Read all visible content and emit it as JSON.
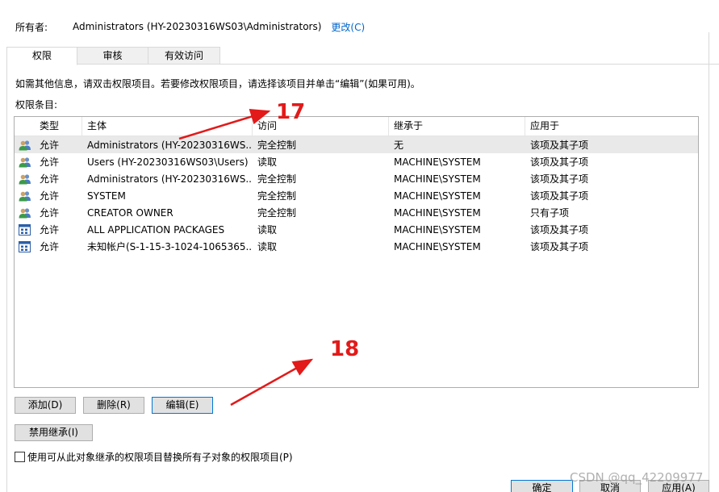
{
  "owner": {
    "label": "所有者:",
    "value": "Administrators (HY-20230316WS03\\Administrators)",
    "change_link": "更改(C)"
  },
  "tabs": [
    {
      "label": "权限",
      "active": true
    },
    {
      "label": "审核",
      "active": false
    },
    {
      "label": "有效访问",
      "active": false
    }
  ],
  "info_text": "如需其他信息，请双击权限项目。若要修改权限项目，请选择该项目并单击“编辑”(如果可用)。",
  "permission_entries_label": "权限条目:",
  "columns": {
    "type": "类型",
    "principal": "主体",
    "access": "访问",
    "inherited_from": "继承于",
    "applies_to": "应用于"
  },
  "rows": [
    {
      "icon": "user-group-icon",
      "type": "允许",
      "principal": "Administrators (HY-20230316WS...",
      "access": "完全控制",
      "inherited_from": "无",
      "applies_to": "该项及其子项",
      "selected": true
    },
    {
      "icon": "user-group-icon",
      "type": "允许",
      "principal": "Users (HY-20230316WS03\\Users)",
      "access": "读取",
      "inherited_from": "MACHINE\\SYSTEM",
      "applies_to": "该项及其子项",
      "selected": false
    },
    {
      "icon": "user-group-icon",
      "type": "允许",
      "principal": "Administrators (HY-20230316WS...",
      "access": "完全控制",
      "inherited_from": "MACHINE\\SYSTEM",
      "applies_to": "该项及其子项",
      "selected": false
    },
    {
      "icon": "user-group-icon",
      "type": "允许",
      "principal": "SYSTEM",
      "access": "完全控制",
      "inherited_from": "MACHINE\\SYSTEM",
      "applies_to": "该项及其子项",
      "selected": false
    },
    {
      "icon": "user-group-icon",
      "type": "允许",
      "principal": "CREATOR OWNER",
      "access": "完全控制",
      "inherited_from": "MACHINE\\SYSTEM",
      "applies_to": "只有子项",
      "selected": false
    },
    {
      "icon": "app-package-icon",
      "type": "允许",
      "principal": "ALL APPLICATION PACKAGES",
      "access": "读取",
      "inherited_from": "MACHINE\\SYSTEM",
      "applies_to": "该项及其子项",
      "selected": false
    },
    {
      "icon": "app-package-icon",
      "type": "允许",
      "principal": "未知帐户(S-1-15-3-1024-1065365...",
      "access": "读取",
      "inherited_from": "MACHINE\\SYSTEM",
      "applies_to": "该项及其子项",
      "selected": false
    }
  ],
  "buttons": {
    "add": "添加(D)",
    "remove": "删除(R)",
    "edit": "编辑(E)",
    "disable_inheritance": "禁用继承(I)",
    "ok": "确定",
    "cancel": "取消",
    "apply": "应用(A)"
  },
  "replace_checkbox": {
    "label": "使用可从此对象继承的权限项目替换所有子对象的权限项目(P)",
    "checked": false
  },
  "annotations": [
    "17",
    "18"
  ],
  "annotation_color": "#e21a1a",
  "watermark": "CSDN @qq_42209977"
}
